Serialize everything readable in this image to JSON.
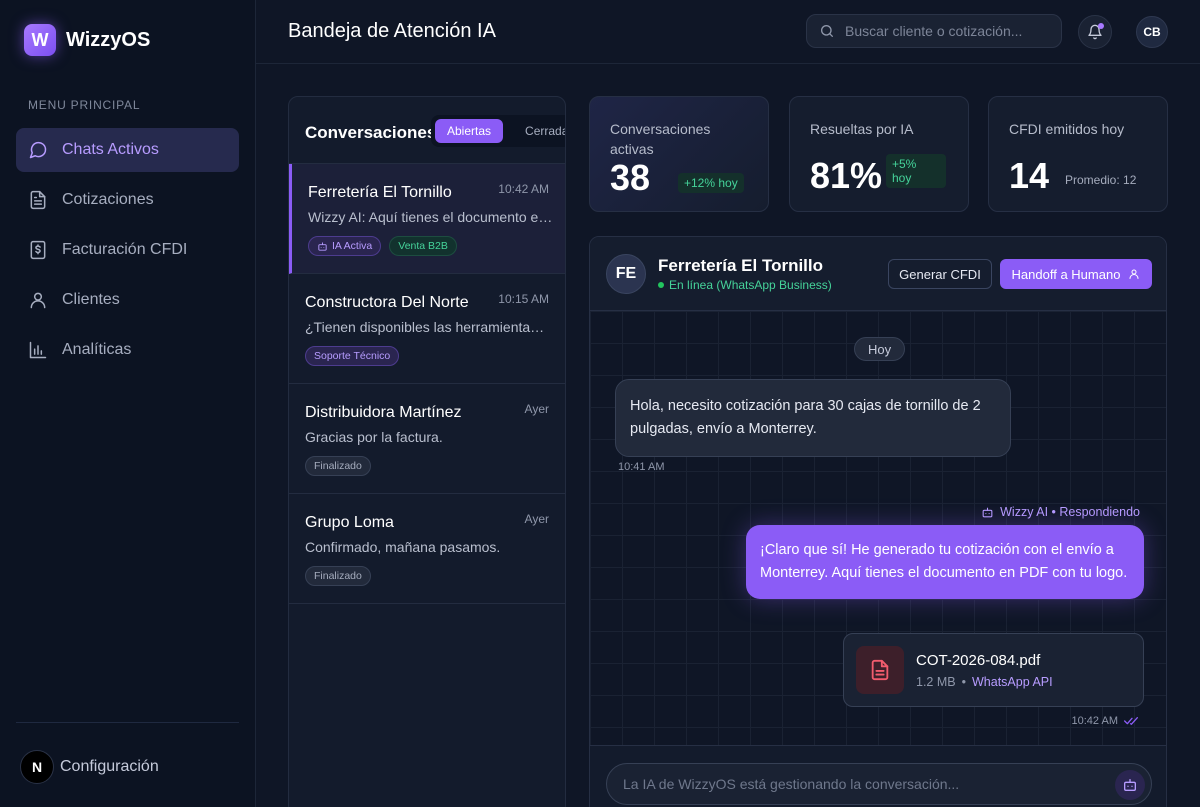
{
  "app": {
    "logo_letter": "W",
    "name": "WizzyOS"
  },
  "sidebar": {
    "section_title": "MENU PRINCIPAL",
    "items": [
      {
        "label": "Chats Activos",
        "icon": "chat-bubble-icon",
        "active": true
      },
      {
        "label": "Cotizaciones",
        "icon": "document-icon"
      },
      {
        "label": "Facturación CFDI",
        "icon": "invoice-icon"
      },
      {
        "label": "Clientes",
        "icon": "user-icon"
      },
      {
        "label": "Analíticas",
        "icon": "bar-chart-icon"
      }
    ],
    "footer": {
      "badge": "N",
      "label": "Configuración"
    }
  },
  "header": {
    "title": "Bandeja de Atención IA",
    "search_placeholder": "Buscar cliente o cotización...",
    "user_initials": "CB"
  },
  "conversations": {
    "title": "Conversaciones",
    "tabs": [
      "Abiertas",
      "Cerradas"
    ],
    "items": [
      {
        "name": "Ferretería El Tornillo",
        "time": "10:42 AM",
        "preview": "Wizzy AI: Aquí tienes el documento en PDF con tu logo.",
        "tags": [
          {
            "label": "IA Activa",
            "style": "purple",
            "icon": "robot-icon"
          },
          {
            "label": "Venta B2B",
            "style": "green"
          }
        ]
      },
      {
        "name": "Constructora Del Norte",
        "time": "10:15 AM",
        "preview": "¿Tienen disponibles las herramientas de corte?",
        "tags": [
          {
            "label": "Soporte Técnico",
            "style": "purple"
          }
        ]
      },
      {
        "name": "Distribuidora Martínez",
        "time": "Ayer",
        "preview": "Gracias por la factura.",
        "tags": [
          {
            "label": "Finalizado",
            "style": "gray"
          }
        ]
      },
      {
        "name": "Grupo Loma",
        "time": "Ayer",
        "preview": "Confirmado, mañana pasamos.",
        "tags": [
          {
            "label": "Finalizado",
            "style": "gray"
          }
        ]
      }
    ]
  },
  "kpis": {
    "active": {
      "label": "Conversaciones activas",
      "value": "38",
      "badge": "+12% hoy"
    },
    "resolved": {
      "label": "Resueltas por IA",
      "value": "81%",
      "badge_line1": "+5%",
      "badge_line2": "hoy"
    },
    "cfdi": {
      "label": "CFDI emitidos hoy",
      "value": "14",
      "sub": "Promedio: 12"
    }
  },
  "chat": {
    "initials": "FE",
    "name": "Ferretería El Tornillo",
    "status": "En línea (WhatsApp Business)",
    "btn_cfdi": "Generar CFDI",
    "btn_handoff": "Handoff a Humano",
    "day": "Hoy",
    "msg_in": "Hola, necesito cotización para 30 cajas de tornillo de 2 pulgadas, envío a Monterrey.",
    "msg_in_time": "10:41 AM",
    "ai_label": "Wizzy AI • Respondiendo",
    "msg_out": "¡Claro que sí! He generado tu cotización con el envío a Monterrey. Aquí tienes el documento en PDF con tu logo.",
    "file": {
      "name": "COT-2026-084.pdf",
      "size": "1.2 MB",
      "sep": "•",
      "source": "WhatsApp API"
    },
    "msg_out_time": "10:42 AM",
    "input_placeholder": "La IA de WizzyOS está gestionando la conversación..."
  },
  "colors": {
    "accent": "#8b5cf6",
    "success": "#45d39a",
    "background": "#0f1626"
  }
}
